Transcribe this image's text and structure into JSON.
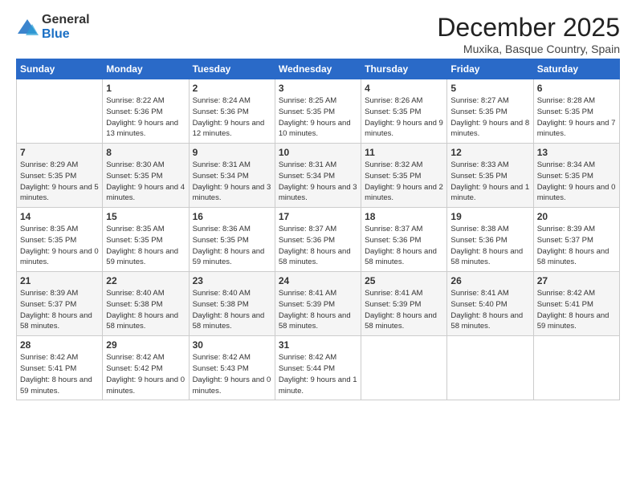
{
  "header": {
    "logo_general": "General",
    "logo_blue": "Blue",
    "title": "December 2025",
    "location": "Muxika, Basque Country, Spain"
  },
  "weekdays": [
    "Sunday",
    "Monday",
    "Tuesday",
    "Wednesday",
    "Thursday",
    "Friday",
    "Saturday"
  ],
  "weeks": [
    [
      {
        "day": "",
        "sunrise": "",
        "sunset": "",
        "daylight": ""
      },
      {
        "day": "1",
        "sunrise": "Sunrise: 8:22 AM",
        "sunset": "Sunset: 5:36 PM",
        "daylight": "Daylight: 9 hours and 13 minutes."
      },
      {
        "day": "2",
        "sunrise": "Sunrise: 8:24 AM",
        "sunset": "Sunset: 5:36 PM",
        "daylight": "Daylight: 9 hours and 12 minutes."
      },
      {
        "day": "3",
        "sunrise": "Sunrise: 8:25 AM",
        "sunset": "Sunset: 5:35 PM",
        "daylight": "Daylight: 9 hours and 10 minutes."
      },
      {
        "day": "4",
        "sunrise": "Sunrise: 8:26 AM",
        "sunset": "Sunset: 5:35 PM",
        "daylight": "Daylight: 9 hours and 9 minutes."
      },
      {
        "day": "5",
        "sunrise": "Sunrise: 8:27 AM",
        "sunset": "Sunset: 5:35 PM",
        "daylight": "Daylight: 9 hours and 8 minutes."
      },
      {
        "day": "6",
        "sunrise": "Sunrise: 8:28 AM",
        "sunset": "Sunset: 5:35 PM",
        "daylight": "Daylight: 9 hours and 7 minutes."
      }
    ],
    [
      {
        "day": "7",
        "sunrise": "Sunrise: 8:29 AM",
        "sunset": "Sunset: 5:35 PM",
        "daylight": "Daylight: 9 hours and 5 minutes."
      },
      {
        "day": "8",
        "sunrise": "Sunrise: 8:30 AM",
        "sunset": "Sunset: 5:35 PM",
        "daylight": "Daylight: 9 hours and 4 minutes."
      },
      {
        "day": "9",
        "sunrise": "Sunrise: 8:31 AM",
        "sunset": "Sunset: 5:34 PM",
        "daylight": "Daylight: 9 hours and 3 minutes."
      },
      {
        "day": "10",
        "sunrise": "Sunrise: 8:31 AM",
        "sunset": "Sunset: 5:34 PM",
        "daylight": "Daylight: 9 hours and 3 minutes."
      },
      {
        "day": "11",
        "sunrise": "Sunrise: 8:32 AM",
        "sunset": "Sunset: 5:35 PM",
        "daylight": "Daylight: 9 hours and 2 minutes."
      },
      {
        "day": "12",
        "sunrise": "Sunrise: 8:33 AM",
        "sunset": "Sunset: 5:35 PM",
        "daylight": "Daylight: 9 hours and 1 minute."
      },
      {
        "day": "13",
        "sunrise": "Sunrise: 8:34 AM",
        "sunset": "Sunset: 5:35 PM",
        "daylight": "Daylight: 9 hours and 0 minutes."
      }
    ],
    [
      {
        "day": "14",
        "sunrise": "Sunrise: 8:35 AM",
        "sunset": "Sunset: 5:35 PM",
        "daylight": "Daylight: 9 hours and 0 minutes."
      },
      {
        "day": "15",
        "sunrise": "Sunrise: 8:35 AM",
        "sunset": "Sunset: 5:35 PM",
        "daylight": "Daylight: 8 hours and 59 minutes."
      },
      {
        "day": "16",
        "sunrise": "Sunrise: 8:36 AM",
        "sunset": "Sunset: 5:35 PM",
        "daylight": "Daylight: 8 hours and 59 minutes."
      },
      {
        "day": "17",
        "sunrise": "Sunrise: 8:37 AM",
        "sunset": "Sunset: 5:36 PM",
        "daylight": "Daylight: 8 hours and 58 minutes."
      },
      {
        "day": "18",
        "sunrise": "Sunrise: 8:37 AM",
        "sunset": "Sunset: 5:36 PM",
        "daylight": "Daylight: 8 hours and 58 minutes."
      },
      {
        "day": "19",
        "sunrise": "Sunrise: 8:38 AM",
        "sunset": "Sunset: 5:36 PM",
        "daylight": "Daylight: 8 hours and 58 minutes."
      },
      {
        "day": "20",
        "sunrise": "Sunrise: 8:39 AM",
        "sunset": "Sunset: 5:37 PM",
        "daylight": "Daylight: 8 hours and 58 minutes."
      }
    ],
    [
      {
        "day": "21",
        "sunrise": "Sunrise: 8:39 AM",
        "sunset": "Sunset: 5:37 PM",
        "daylight": "Daylight: 8 hours and 58 minutes."
      },
      {
        "day": "22",
        "sunrise": "Sunrise: 8:40 AM",
        "sunset": "Sunset: 5:38 PM",
        "daylight": "Daylight: 8 hours and 58 minutes."
      },
      {
        "day": "23",
        "sunrise": "Sunrise: 8:40 AM",
        "sunset": "Sunset: 5:38 PM",
        "daylight": "Daylight: 8 hours and 58 minutes."
      },
      {
        "day": "24",
        "sunrise": "Sunrise: 8:41 AM",
        "sunset": "Sunset: 5:39 PM",
        "daylight": "Daylight: 8 hours and 58 minutes."
      },
      {
        "day": "25",
        "sunrise": "Sunrise: 8:41 AM",
        "sunset": "Sunset: 5:39 PM",
        "daylight": "Daylight: 8 hours and 58 minutes."
      },
      {
        "day": "26",
        "sunrise": "Sunrise: 8:41 AM",
        "sunset": "Sunset: 5:40 PM",
        "daylight": "Daylight: 8 hours and 58 minutes."
      },
      {
        "day": "27",
        "sunrise": "Sunrise: 8:42 AM",
        "sunset": "Sunset: 5:41 PM",
        "daylight": "Daylight: 8 hours and 59 minutes."
      }
    ],
    [
      {
        "day": "28",
        "sunrise": "Sunrise: 8:42 AM",
        "sunset": "Sunset: 5:41 PM",
        "daylight": "Daylight: 8 hours and 59 minutes."
      },
      {
        "day": "29",
        "sunrise": "Sunrise: 8:42 AM",
        "sunset": "Sunset: 5:42 PM",
        "daylight": "Daylight: 9 hours and 0 minutes."
      },
      {
        "day": "30",
        "sunrise": "Sunrise: 8:42 AM",
        "sunset": "Sunset: 5:43 PM",
        "daylight": "Daylight: 9 hours and 0 minutes."
      },
      {
        "day": "31",
        "sunrise": "Sunrise: 8:42 AM",
        "sunset": "Sunset: 5:44 PM",
        "daylight": "Daylight: 9 hours and 1 minute."
      },
      {
        "day": "",
        "sunrise": "",
        "sunset": "",
        "daylight": ""
      },
      {
        "day": "",
        "sunrise": "",
        "sunset": "",
        "daylight": ""
      },
      {
        "day": "",
        "sunrise": "",
        "sunset": "",
        "daylight": ""
      }
    ]
  ]
}
